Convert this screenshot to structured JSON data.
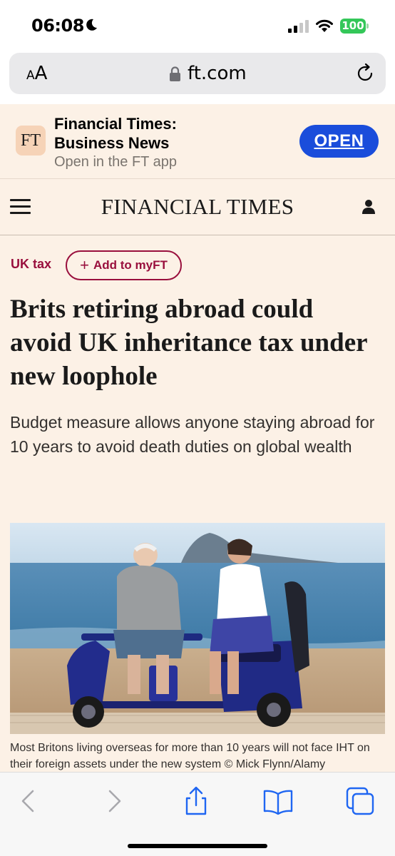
{
  "status_bar": {
    "time": "06:08",
    "battery": "100",
    "battery_color": "#34c759"
  },
  "browser": {
    "text_size_label_small": "A",
    "text_size_label_large": "A",
    "url": "ft.com"
  },
  "app_banner": {
    "app_name_line1": "Financial Times:",
    "app_name_line2": "Business News",
    "subtitle": "Open in the FT app",
    "logo_text": "FT",
    "open_label": "OPEN",
    "button_color": "#1a4ddb"
  },
  "header": {
    "masthead": "FINANCIAL TIMES"
  },
  "article": {
    "topic": "UK tax",
    "myft_label": "Add to myFT",
    "headline": "Brits retiring abroad could avoid UK inheritance tax under new loophole",
    "standfirst": "Budget measure allows anyone staying abroad for 10 years to avoid death duties on global wealth",
    "caption": "Most Britons living overseas for more than 10 years will not face IHT on their foreign assets under the new system © Mick Flynn/Alamy",
    "accent_color": "#990f3d",
    "page_background": "#fcf1e6"
  },
  "toolbar": {
    "icons": [
      "back-icon",
      "forward-icon",
      "share-icon",
      "bookmarks-icon",
      "tabs-icon"
    ]
  }
}
